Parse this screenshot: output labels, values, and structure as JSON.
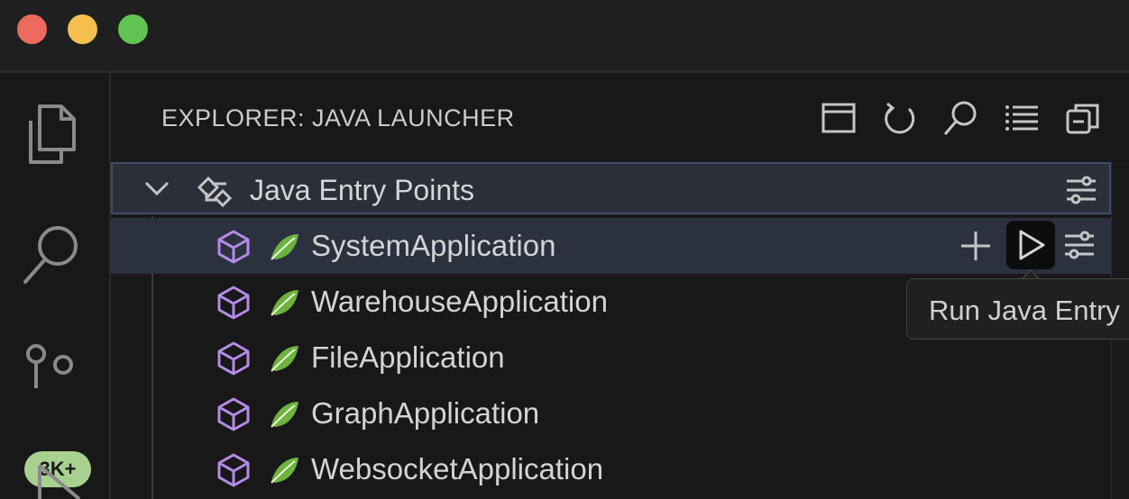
{
  "window": {
    "traffic_lights": [
      "close",
      "minimize",
      "maximize"
    ]
  },
  "activity_bar": {
    "items": [
      {
        "icon": "files-icon"
      },
      {
        "icon": "search-icon"
      },
      {
        "icon": "source-control-icon",
        "badge": "3K+"
      },
      {
        "icon": "run-debug-icon"
      }
    ],
    "badge_color": "#a8d190"
  },
  "sidebar": {
    "title": "EXPLORER: JAVA LAUNCHER",
    "actions": [
      "layout-panel-icon",
      "refresh-icon",
      "search-icon",
      "list-view-icon",
      "collapse-all-icon"
    ]
  },
  "section": {
    "label": "Java Entry Points",
    "expanded": true,
    "icon": "entry-points-icon",
    "filter_icon": "filter-settings-icon"
  },
  "entries": [
    {
      "label": "SystemApplication",
      "selected": true
    },
    {
      "label": "WarehouseApplication",
      "selected": false
    },
    {
      "label": "FileApplication",
      "selected": false
    },
    {
      "label": "GraphApplication",
      "selected": false
    },
    {
      "label": "WebsocketApplication",
      "selected": false
    }
  ],
  "row_actions": [
    "add-icon",
    "run-icon",
    "settings-icon"
  ],
  "tooltip": {
    "text": "Run Java Entry"
  },
  "colors": {
    "cube_icon": "#b38be6",
    "spring_leaf": "#6db33f",
    "selection": "#2c3140",
    "section_border": "#3f4d6a"
  }
}
